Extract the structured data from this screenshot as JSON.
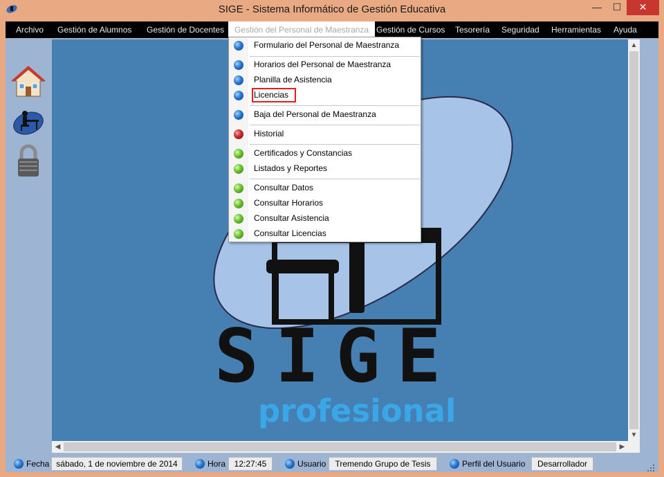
{
  "window": {
    "title": "SIGE - Sistema Informático de Gestión Educativa",
    "minimize_glyph": "—",
    "maximize_glyph": "☐",
    "close_glyph": "✕"
  },
  "menubar": {
    "items": [
      {
        "label": "Archivo"
      },
      {
        "label": "Gestión de  Alumnos"
      },
      {
        "label": "Gestión de Docentes"
      },
      {
        "label": "Gestión del Personal de Maestranza"
      },
      {
        "label": "Gestión de Cursos"
      },
      {
        "label": "Tesorería"
      },
      {
        "label": "Seguridad"
      },
      {
        "label": "Herramientas"
      },
      {
        "label": "Ayuda"
      }
    ]
  },
  "dropdown": {
    "items": [
      {
        "label": "Formulario del Personal de Maestranza",
        "icon": "blue-bullet-icon"
      },
      {
        "label": "Horarios del Personal de Maestranza",
        "icon": "blue-bullet-icon"
      },
      {
        "label": "Planilla de Asistencia",
        "icon": "blue-bullet-icon"
      },
      {
        "label": "Licencias",
        "icon": "blue-bullet-icon"
      },
      {
        "label": "Baja del Personal de Maestranza",
        "icon": "blue-bullet-icon"
      },
      {
        "label": "Historial",
        "icon": "red-bullet-icon"
      },
      {
        "label": "Certificados y Constancias",
        "icon": "green-bullet-icon"
      },
      {
        "label": "Listados y Reportes",
        "icon": "green-bullet-icon"
      },
      {
        "label": "Consultar Datos",
        "icon": "green-bullet-icon"
      },
      {
        "label": "Consultar Horarios",
        "icon": "green-bullet-icon"
      },
      {
        "label": "Consultar Asistencia",
        "icon": "green-bullet-icon"
      },
      {
        "label": "Consultar Licencias",
        "icon": "green-bullet-icon"
      }
    ]
  },
  "sidebar": {
    "icons": [
      "home-icon",
      "teacher-desk-icon",
      "padlock-icon"
    ]
  },
  "logo": {
    "big_text": "SIGE",
    "sub_text": "profesional"
  },
  "statusbar": {
    "fecha_label": "Fecha",
    "fecha_value": "sábado, 1 de noviembre de 2014",
    "hora_label": "Hora",
    "hora_value": "12:27:45",
    "usuario_label": "Usuario",
    "usuario_value": "Tremendo Grupo de Tesis",
    "perfil_label": "Perfil del Usuario",
    "perfil_value": "Desarrollador"
  },
  "colors": {
    "titlebar": "#e8a983",
    "menubar": "#000000",
    "canvas": "#4680b3",
    "panel": "#9db4d3",
    "highlight_box": "#e31e1e",
    "logo_sub": "#3aa8e8"
  }
}
